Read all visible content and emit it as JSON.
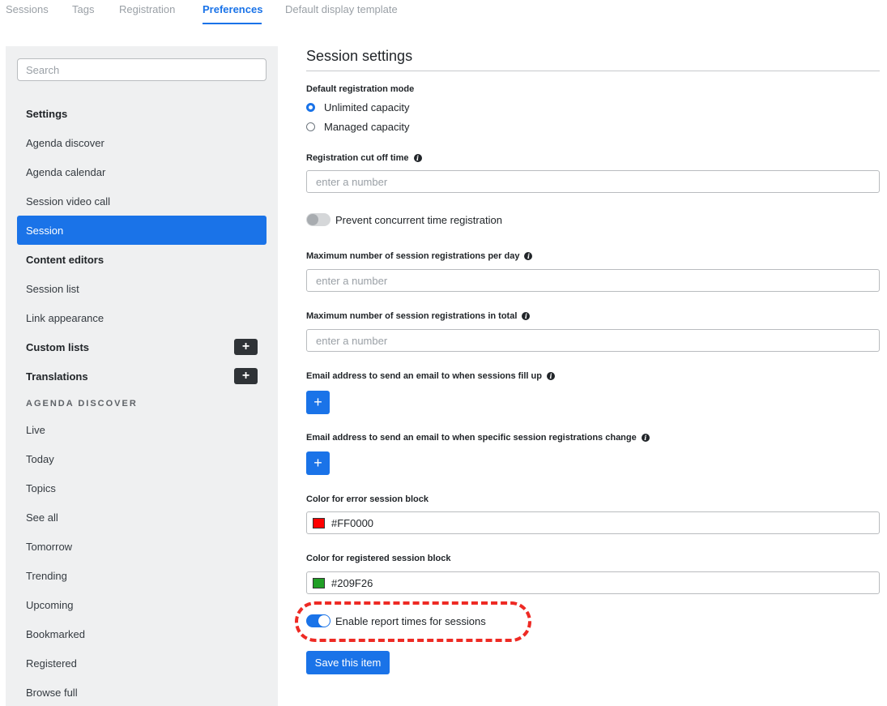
{
  "tabs": [
    {
      "label": "Sessions"
    },
    {
      "label": "Tags"
    },
    {
      "label": "Registration"
    },
    {
      "label": "Preferences",
      "active": true
    },
    {
      "label": "Default display template"
    }
  ],
  "sidebar": {
    "search_placeholder": "Search",
    "items": [
      {
        "label": "Settings",
        "type": "heading"
      },
      {
        "label": "Agenda discover"
      },
      {
        "label": "Agenda calendar"
      },
      {
        "label": "Session video call"
      },
      {
        "label": "Session",
        "active": true
      },
      {
        "label": "Content editors",
        "type": "heading"
      },
      {
        "label": "Session list"
      },
      {
        "label": "Link appearance"
      },
      {
        "label": "Custom lists",
        "type": "heading",
        "add_icon": "plus-icon"
      },
      {
        "label": "Translations",
        "type": "heading",
        "add_icon": "plus-icon"
      },
      {
        "label": "AGENDA DISCOVER",
        "type": "caption"
      },
      {
        "label": "Live"
      },
      {
        "label": "Today"
      },
      {
        "label": "Topics"
      },
      {
        "label": "See all"
      },
      {
        "label": "Tomorrow"
      },
      {
        "label": "Trending"
      },
      {
        "label": "Upcoming"
      },
      {
        "label": "Bookmarked"
      },
      {
        "label": "Registered"
      },
      {
        "label": "Browse full"
      }
    ],
    "add_symbol": "+"
  },
  "form": {
    "title": "Session settings",
    "registration_mode": {
      "label": "Default registration mode",
      "options": [
        "Unlimited capacity",
        "Managed capacity"
      ],
      "selected": "Unlimited capacity"
    },
    "cutoff": {
      "label": "Registration cut off time",
      "placeholder": "enter a number",
      "value": ""
    },
    "prevent_concurrent": {
      "label": "Prevent concurrent time registration",
      "enabled": false
    },
    "max_per_day": {
      "label": "Maximum number of session registrations per day",
      "placeholder": "enter a number",
      "value": ""
    },
    "max_total": {
      "label": "Maximum number of session registrations in total",
      "placeholder": "enter a number",
      "value": ""
    },
    "email_fill_up": {
      "label": "Email address to send an email to when sessions fill up",
      "button": "+"
    },
    "email_change": {
      "label": "Email address to send an email to when specific session registrations change",
      "button": "+"
    },
    "error_color": {
      "label": "Color for error session block",
      "value": "#FF0000",
      "swatch": "#FF0000"
    },
    "registered_color": {
      "label": "Color for registered session block",
      "value": "#209F26",
      "swatch": "#209F26"
    },
    "report_times": {
      "label": "Enable report times for sessions",
      "enabled": true
    },
    "save_label": "Save this item",
    "info_glyph": "i"
  },
  "colors": {
    "accent": "#1a73e8",
    "highlight": "#ee2a24",
    "sidebar_bg": "#eff0f1"
  }
}
